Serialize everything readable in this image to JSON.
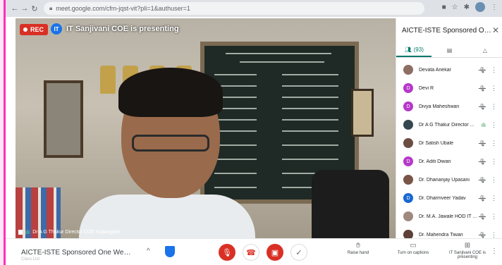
{
  "browser": {
    "url": "meet.google.com/cfm-jqst-vit?pli=1&authuser=1"
  },
  "video": {
    "rec_label": "REC",
    "presenter_initials": "IT",
    "presenting_text": "IT Sanjivani COE is presenting",
    "speaker_tag": "Dr A G Thakur Director COE Kopargaon"
  },
  "panel": {
    "title": "AICTE-ISTE Sponsored One Week...",
    "participants_tab": "(93)",
    "participants": [
      {
        "name": "Devata Anekar",
        "initial": "",
        "color": "#8d6e63",
        "mic": "muted"
      },
      {
        "name": "Devi R",
        "initial": "D",
        "color": "#b638c9",
        "mic": "muted"
      },
      {
        "name": "Divya Maheshwari",
        "initial": "D",
        "color": "#b638c9",
        "mic": "muted"
      },
      {
        "name": "Dr A G Thakur Director ...",
        "initial": "",
        "color": "#37474f",
        "mic": "active"
      },
      {
        "name": "Dr Satish Ubale",
        "initial": "",
        "color": "#6d4c41",
        "mic": "muted"
      },
      {
        "name": "Dr. Aditi Diwan",
        "initial": "D",
        "color": "#b638c9",
        "mic": "muted"
      },
      {
        "name": "Dr. Dhananjay Upasani",
        "initial": "",
        "color": "#795548",
        "mic": "muted"
      },
      {
        "name": "Dr. Dharmveer Yadav",
        "initial": "D",
        "color": "#1967d2",
        "mic": "muted"
      },
      {
        "name": "Dr. M.A. Jawale HOD IT ...",
        "initial": "",
        "color": "#a1887f",
        "mic": "muted"
      },
      {
        "name": "Dr. Mahendra Tiwari",
        "initial": "",
        "color": "#5d4037",
        "mic": "muted"
      }
    ]
  },
  "bottom": {
    "meeting_title": "AICTE-ISTE Sponsored One Week Inducti...",
    "sub_title": "Class List",
    "raise_hand": "Raise hand",
    "captions": "Turn on captions",
    "presenting": "IT Sanjivani COE is presenting"
  }
}
